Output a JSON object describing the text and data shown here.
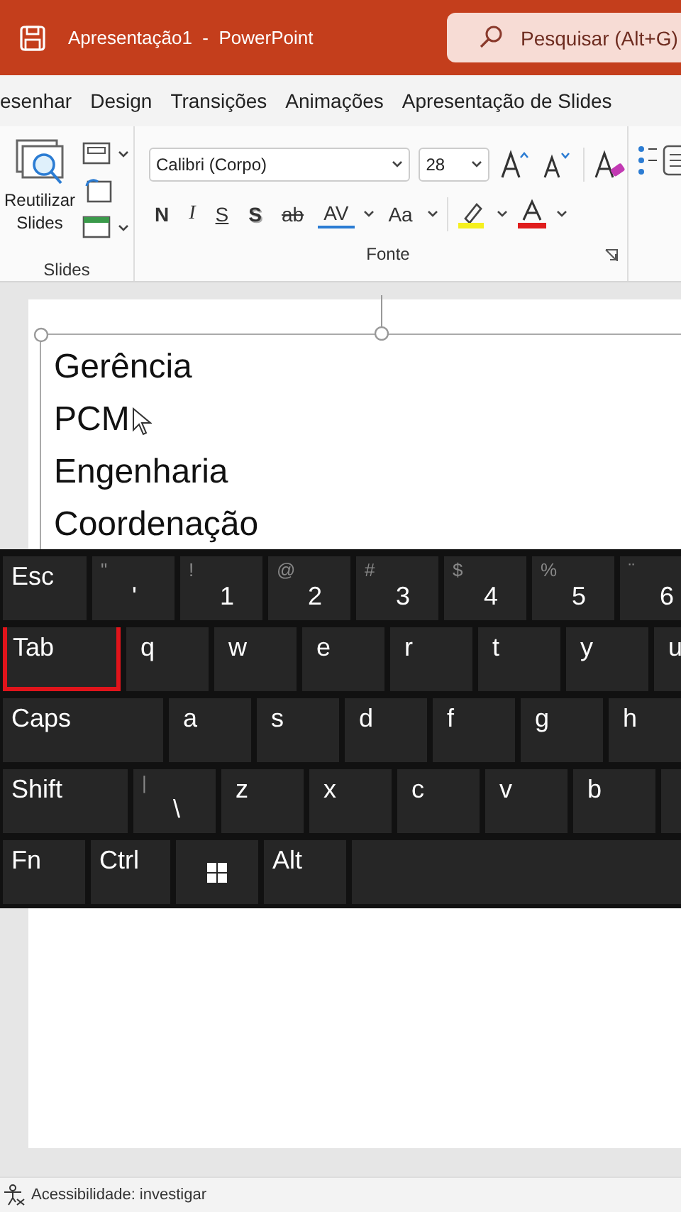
{
  "window": {
    "title": "Apresentação1  -  PowerPoint",
    "search": {
      "placeholder": "Pesquisar (Alt+G)"
    }
  },
  "tabs": [
    {
      "label": "esenhar",
      "selected": false
    },
    {
      "label": "Design",
      "selected": false
    },
    {
      "label": "Transições",
      "selected": false
    },
    {
      "label": "Animações",
      "selected": false
    },
    {
      "label": "Apresentação de Slides",
      "selected": false
    }
  ],
  "ribbon": {
    "slides_group": {
      "reuse_button": "Reutilizar Slides",
      "label": "Slides"
    },
    "font_group": {
      "font": "Calibri (Corpo)",
      "size": "28",
      "label": "Fonte",
      "buttons": [
        {
          "label": "N",
          "kind": "bold"
        },
        {
          "label": "I",
          "kind": "italic"
        },
        {
          "label": "S",
          "kind": "underline"
        },
        {
          "label": "S",
          "kind": "shadow"
        },
        {
          "label": "ab",
          "kind": "strike"
        },
        {
          "label": "AV",
          "kind": "spacing"
        },
        {
          "label": "Aa",
          "kind": "case"
        }
      ]
    }
  },
  "slide": {
    "lines": [
      "Gerência",
      "PCM",
      "Engenharia",
      "Coordenação"
    ]
  },
  "keyboard": {
    "rows": [
      {
        "keys": [
          {
            "label": "Esc",
            "kind": "mod",
            "highlighted": false
          },
          {
            "label": "'",
            "shift": "\"",
            "kind": "char",
            "highlighted": false
          },
          {
            "label": "1",
            "shift": "!",
            "kind": "char",
            "highlighted": false
          },
          {
            "label": "2",
            "shift": "@",
            "kind": "char",
            "highlighted": false
          },
          {
            "label": "3",
            "shift": "#",
            "kind": "char",
            "highlighted": false
          },
          {
            "label": "4",
            "shift": "$",
            "kind": "char",
            "highlighted": false
          },
          {
            "label": "5",
            "shift": "%",
            "kind": "char",
            "highlighted": false
          },
          {
            "label": "6",
            "shift": "¨",
            "kind": "char",
            "highlighted": false
          }
        ]
      },
      {
        "keys": [
          {
            "label": "Tab",
            "kind": "mod",
            "highlighted": true
          },
          {
            "label": "q",
            "kind": "char",
            "highlighted": false
          },
          {
            "label": "w",
            "kind": "char",
            "highlighted": false
          },
          {
            "label": "e",
            "kind": "char",
            "highlighted": false
          },
          {
            "label": "r",
            "kind": "char",
            "highlighted": false
          },
          {
            "label": "t",
            "kind": "char",
            "highlighted": false
          },
          {
            "label": "y",
            "kind": "char",
            "highlighted": false
          },
          {
            "label": "u",
            "kind": "char",
            "highlighted": false
          }
        ]
      },
      {
        "keys": [
          {
            "label": "Caps",
            "kind": "mod",
            "highlighted": false
          },
          {
            "label": "a",
            "kind": "char",
            "highlighted": false
          },
          {
            "label": "s",
            "kind": "char",
            "highlighted": false
          },
          {
            "label": "d",
            "kind": "char",
            "highlighted": false
          },
          {
            "label": "f",
            "kind": "char",
            "highlighted": false
          },
          {
            "label": "g",
            "kind": "char",
            "highlighted": false
          },
          {
            "label": "h",
            "kind": "char",
            "highlighted": false
          }
        ]
      },
      {
        "keys": [
          {
            "label": "Shift",
            "kind": "mod",
            "highlighted": false
          },
          {
            "label": "\\",
            "shift": "|",
            "kind": "char",
            "highlighted": false
          },
          {
            "label": "z",
            "kind": "char",
            "highlighted": false
          },
          {
            "label": "x",
            "kind": "char",
            "highlighted": false
          },
          {
            "label": "c",
            "kind": "char",
            "highlighted": false
          },
          {
            "label": "v",
            "kind": "char",
            "highlighted": false
          },
          {
            "label": "b",
            "kind": "char",
            "highlighted": false
          },
          {
            "kind": "char",
            "highlighted": false
          }
        ]
      },
      {
        "keys": [
          {
            "label": "Fn",
            "kind": "mod",
            "highlighted": false
          },
          {
            "label": "Ctrl",
            "kind": "mod",
            "highlighted": false
          },
          {
            "kind": "windows",
            "highlighted": false
          },
          {
            "label": "Alt",
            "kind": "mod",
            "highlighted": false
          },
          {
            "kind": "space",
            "highlighted": false
          }
        ]
      }
    ]
  },
  "status_bar": {
    "accessibility": "Acessibilidade: investigar"
  }
}
